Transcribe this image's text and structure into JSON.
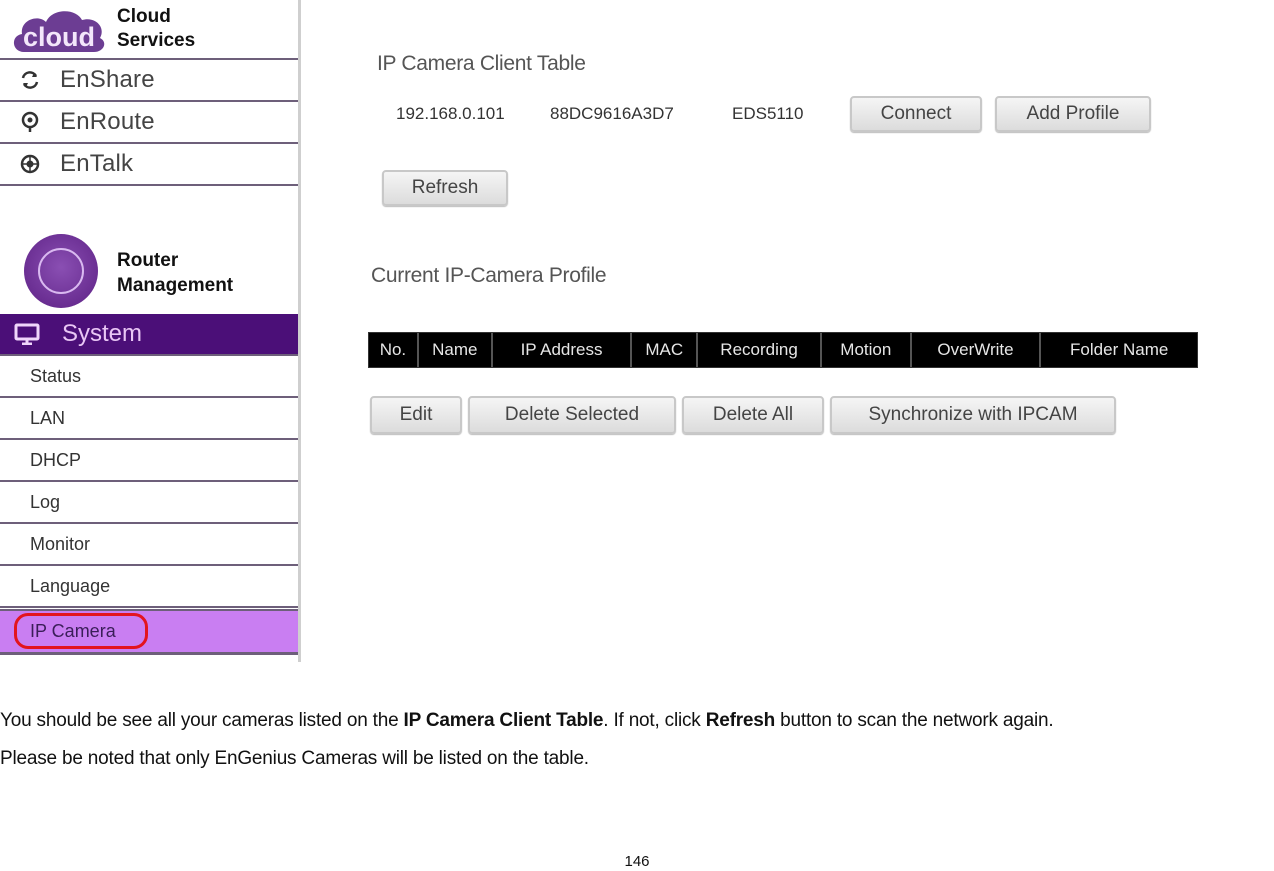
{
  "sidebar": {
    "cloud_brand": {
      "logo_text": "cloud",
      "line1": "Cloud",
      "line2": "Services"
    },
    "cloud_items": [
      {
        "label": "EnShare",
        "icon": "sync-icon"
      },
      {
        "label": "EnRoute",
        "icon": "location-pin-icon"
      },
      {
        "label": "EnTalk",
        "icon": "chat-globe-icon"
      }
    ],
    "router_brand": {
      "line1": "Router",
      "line2": "Management"
    },
    "section": {
      "label": "System",
      "icon": "monitor-icon"
    },
    "sub_items": [
      {
        "label": "Status"
      },
      {
        "label": "LAN"
      },
      {
        "label": "DHCP"
      },
      {
        "label": "Log"
      },
      {
        "label": "Monitor"
      },
      {
        "label": "Language"
      },
      {
        "label": "IP Camera",
        "active": true,
        "highlighted": true
      }
    ],
    "colors": {
      "section_bg": "#4b0f78",
      "active_bg": "#c97ef2",
      "highlight_ring": "#e3141e"
    }
  },
  "client_table": {
    "title": "IP Camera Client Table",
    "row": {
      "ip": "192.168.0.101",
      "mac": "88DC9616A3D7",
      "model": "EDS5110"
    },
    "connect_label": "Connect",
    "add_profile_label": "Add Profile",
    "refresh_label": "Refresh"
  },
  "profile": {
    "title": "Current IP-Camera Profile",
    "columns": [
      "No.",
      "Name",
      "IP Address",
      "MAC",
      "Recording",
      "Motion",
      "OverWrite",
      "Folder Name"
    ],
    "rows": [],
    "buttons": {
      "edit": "Edit",
      "delete_selected": "Delete Selected",
      "delete_all": "Delete All",
      "sync": "Synchronize with IPCAM"
    }
  },
  "doc": {
    "line1": {
      "t1": "You should be see all your cameras listed on the ",
      "b1": "IP Camera Client Table",
      "t2": ". If not, click ",
      "b2": "Refresh",
      "t3": " button to scan the network again."
    },
    "line2": "Please be noted that only EnGenius Cameras will be listed on the table.",
    "page_number": "146"
  }
}
